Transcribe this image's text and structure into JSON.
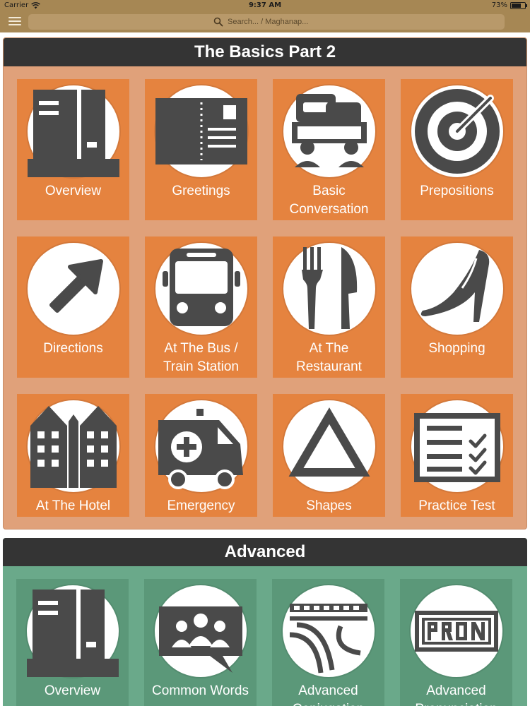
{
  "status_bar": {
    "carrier": "Carrier",
    "time": "9:37 AM",
    "battery": "73%",
    "battery_level": 0.73
  },
  "nav": {
    "menu_icon": "hamburger-menu-icon",
    "search_icon": "search-icon",
    "search_placeholder": "Search... / Maghanap..."
  },
  "colors": {
    "bar": "#a68754",
    "header": "#343434",
    "basics_bg": "#e0a17a",
    "basics_tile": "#e5833f",
    "advanced_bg": "#6aa98a",
    "advanced_tile": "#5b9879",
    "icon": "#4a4a4a"
  },
  "basics": {
    "title": "The Basics Part 2",
    "tiles": [
      {
        "label": "Overview",
        "icon": "document-icon"
      },
      {
        "label": "Greetings",
        "icon": "postcard-icon"
      },
      {
        "label": "Basic\nConversation",
        "icon": "chat-people-icon"
      },
      {
        "label": "Prepositions",
        "icon": "target-icon"
      },
      {
        "label": "Directions",
        "icon": "arrow-up-right-icon"
      },
      {
        "label": "At The Bus /\nTrain Station",
        "icon": "bus-icon"
      },
      {
        "label": "At The\nRestaurant",
        "icon": "fork-knife-icon"
      },
      {
        "label": "Shopping",
        "icon": "high-heel-icon"
      },
      {
        "label": "At The Hotel",
        "icon": "hotel-icon"
      },
      {
        "label": "Emergency",
        "icon": "ambulance-icon"
      },
      {
        "label": "Shapes",
        "icon": "triangle-icon"
      },
      {
        "label": "Practice Test",
        "icon": "checklist-icon"
      }
    ]
  },
  "advanced": {
    "title": "Advanced",
    "tiles": [
      {
        "label": "Overview",
        "icon": "document-icon"
      },
      {
        "label": "Common Words",
        "icon": "group-chat-icon"
      },
      {
        "label": "Advanced\nConjugation",
        "icon": "bridge-icon"
      },
      {
        "label": "Advanced\nPronunciation",
        "icon": "pron-sign-icon"
      }
    ]
  }
}
